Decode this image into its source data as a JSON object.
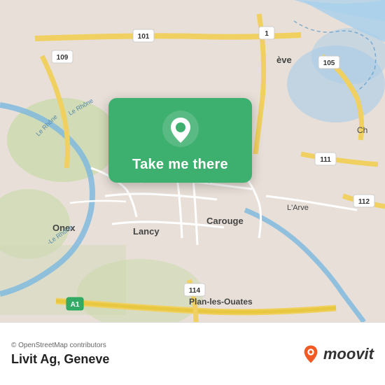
{
  "map": {
    "attribution": "© OpenStreetMap contributors",
    "location_name": "Livit Ag, Geneve",
    "card": {
      "button_label": "Take me there"
    }
  },
  "moovit": {
    "logo_text": "moovit"
  },
  "colors": {
    "green": "#3daf6e",
    "road_yellow": "#f0d060",
    "road_white": "#ffffff",
    "water_blue": "#a8d4f0",
    "land_light": "#eae6df",
    "land_green": "#c8dbb0"
  }
}
